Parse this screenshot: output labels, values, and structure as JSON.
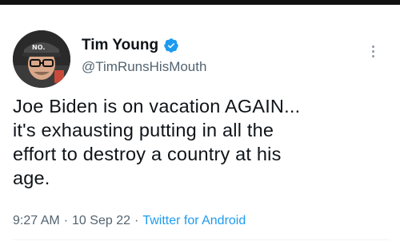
{
  "tweet": {
    "author": {
      "name": "Tim Young",
      "handle": "@TimRunsHisMouth",
      "verified": true
    },
    "text_lines": [
      "Joe Biden is on vacation AGAIN...",
      "it's exhausting putting in all the",
      "effort to destroy a country at his",
      "age."
    ],
    "time": "9:27 AM",
    "date": "10 Sep 22",
    "separator": "·",
    "source": "Twitter for Android"
  },
  "colors": {
    "text": "#0f1419",
    "secondary": "#536471",
    "accent": "#1d9bf0",
    "verified": "#1d9bf0"
  },
  "icons": {
    "verified": "verified-badge-icon",
    "more": "more-options-icon"
  }
}
